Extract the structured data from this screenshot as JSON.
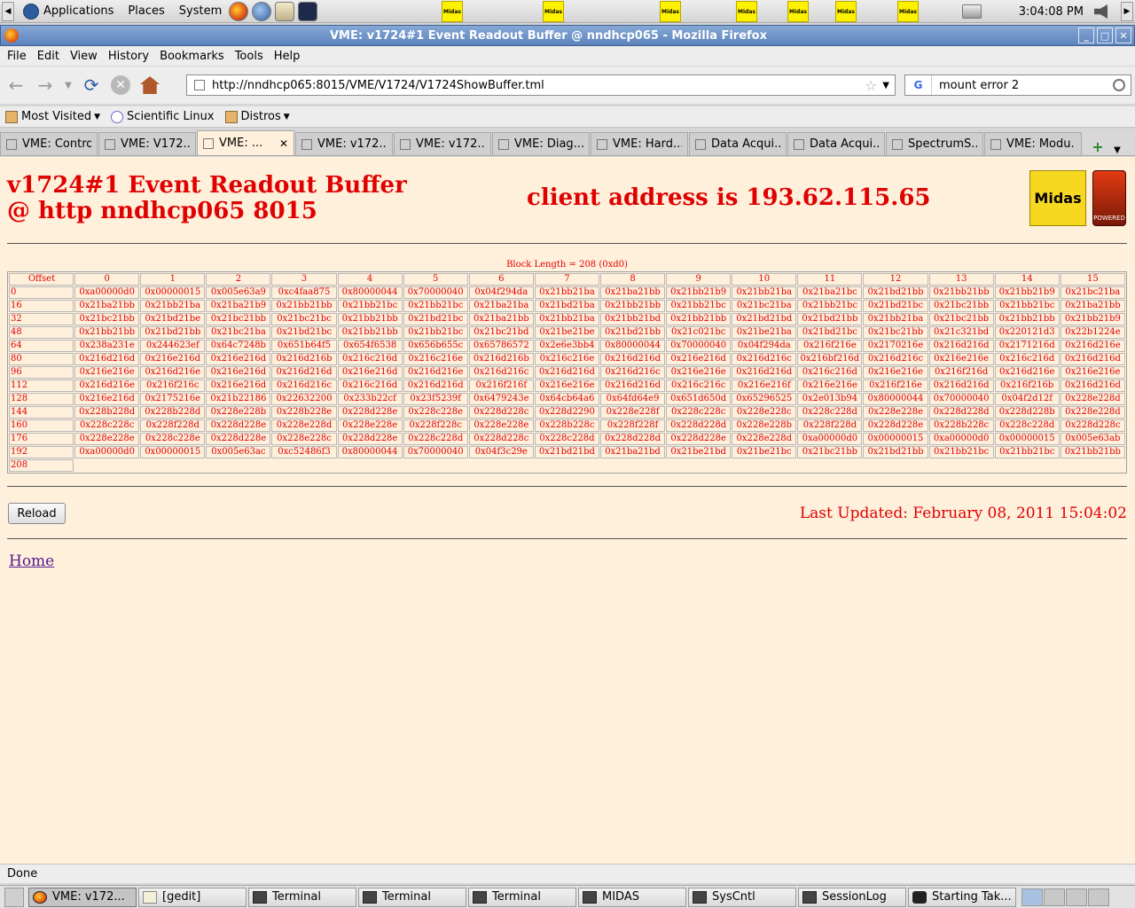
{
  "panel": {
    "menus": [
      "Applications",
      "Places",
      "System"
    ],
    "clock": "3:04:08 PM",
    "tray_label": "Midas"
  },
  "window": {
    "title": "VME: v1724#1 Event Readout Buffer @ nndhcp065 - Mozilla Firefox"
  },
  "menubar": [
    "File",
    "Edit",
    "View",
    "History",
    "Bookmarks",
    "Tools",
    "Help"
  ],
  "navbar": {
    "url": "http://nndhcp065:8015/VME/V1724/V1724ShowBuffer.tml",
    "search": "mount error 2",
    "search_engine": "G"
  },
  "bookmarks": [
    "Most Visited",
    "Scientific Linux",
    "Distros"
  ],
  "tabs": [
    {
      "label": "VME: Control"
    },
    {
      "label": "VME: V172..."
    },
    {
      "label": "VME: ..."
    },
    {
      "label": "VME: v172..."
    },
    {
      "label": "VME: v172..."
    },
    {
      "label": "VME: Diag..."
    },
    {
      "label": "VME: Hard..."
    },
    {
      "label": "Data Acqui..."
    },
    {
      "label": "Data Acqui..."
    },
    {
      "label": "SpectrumS..."
    },
    {
      "label": "VME: Modu..."
    }
  ],
  "page": {
    "heading": "v1724#1 Event Readout Buffer @ http nndhcp065 8015",
    "client": "client address is 193.62.115.65",
    "midas_logo": "Midas",
    "tcl_logo": "POWERED",
    "block_length": "Block Length = 208 (0xd0)",
    "columns": [
      "Offset",
      "0",
      "1",
      "2",
      "3",
      "4",
      "5",
      "6",
      "7",
      "8",
      "9",
      "10",
      "11",
      "12",
      "13",
      "14",
      "15"
    ],
    "rows": [
      [
        "0",
        "0xa00000d0",
        "0x00000015",
        "0x005e63a9",
        "0xc4faa875",
        "0x80000044",
        "0x70000040",
        "0x04f294da",
        "0x21bb21ba",
        "0x21ba21bb",
        "0x21bb21b9",
        "0x21bb21ba",
        "0x21ba21bc",
        "0x21bd21bb",
        "0x21bb21bb",
        "0x21bb21b9",
        "0x21bc21ba"
      ],
      [
        "16",
        "0x21ba21bb",
        "0x21bb21ba",
        "0x21ba21b9",
        "0x21bb21bb",
        "0x21bb21bc",
        "0x21bb21bc",
        "0x21ba21ba",
        "0x21bd21ba",
        "0x21bb21bb",
        "0x21bb21bc",
        "0x21bc21ba",
        "0x21bb21bc",
        "0x21bd21bc",
        "0x21bc21bb",
        "0x21bb21bc",
        "0x21ba21bb"
      ],
      [
        "32",
        "0x21bc21bb",
        "0x21bd21be",
        "0x21bc21bb",
        "0x21bc21bc",
        "0x21bb21bb",
        "0x21bd21bc",
        "0x21ba21bb",
        "0x21bb21ba",
        "0x21bb21bd",
        "0x21bb21bb",
        "0x21bd21bd",
        "0x21bd21bb",
        "0x21bb21ba",
        "0x21bc21bb",
        "0x21bb21bb",
        "0x21bb21b9"
      ],
      [
        "48",
        "0x21bb21bb",
        "0x21bd21bb",
        "0x21bc21ba",
        "0x21bd21bc",
        "0x21bb21bb",
        "0x21bb21bc",
        "0x21bc21bd",
        "0x21be21be",
        "0x21bd21bb",
        "0x21c021bc",
        "0x21be21ba",
        "0x21bd21bc",
        "0x21bc21bb",
        "0x21c321bd",
        "0x220121d3",
        "0x22b1224e"
      ],
      [
        "64",
        "0x238a231e",
        "0x244623ef",
        "0x64c7248b",
        "0x651b64f5",
        "0x654f6538",
        "0x656b655c",
        "0x65786572",
        "0x2e6e3bb4",
        "0x80000044",
        "0x70000040",
        "0x04f294da",
        "0x216f216e",
        "0x2170216e",
        "0x216d216d",
        "0x2171216d",
        "0x216d216e"
      ],
      [
        "80",
        "0x216d216d",
        "0x216e216d",
        "0x216e216d",
        "0x216d216b",
        "0x216c216d",
        "0x216c216e",
        "0x216d216b",
        "0x216c216e",
        "0x216d216d",
        "0x216e216d",
        "0x216d216c",
        "0x216bf216d",
        "0x216d216c",
        "0x216e216e",
        "0x216c216d",
        "0x216d216d"
      ],
      [
        "96",
        "0x216e216e",
        "0x216d216e",
        "0x216e216d",
        "0x216d216d",
        "0x216e216d",
        "0x216d216e",
        "0x216d216c",
        "0x216d216d",
        "0x216d216c",
        "0x216e216e",
        "0x216d216d",
        "0x216c216d",
        "0x216e216e",
        "0x216f216d",
        "0x216d216e",
        "0x216e216e"
      ],
      [
        "112",
        "0x216d216e",
        "0x216f216c",
        "0x216e216d",
        "0x216d216c",
        "0x216c216d",
        "0x216d216d",
        "0x216f216f",
        "0x216e216e",
        "0x216d216d",
        "0x216c216c",
        "0x216e216f",
        "0x216e216e",
        "0x216f216e",
        "0x216d216d",
        "0x216f216b",
        "0x216d216d"
      ],
      [
        "128",
        "0x216e216d",
        "0x2175216e",
        "0x21b22186",
        "0x22632200",
        "0x233b22cf",
        "0x23f5239f",
        "0x6479243e",
        "0x64cb64a6",
        "0x64fd64e9",
        "0x651d650d",
        "0x65296525",
        "0x2e013b94",
        "0x80000044",
        "0x70000040",
        "0x04f2d12f",
        "0x228e228d"
      ],
      [
        "144",
        "0x228b228d",
        "0x228b228d",
        "0x228e228b",
        "0x228b228e",
        "0x228d228e",
        "0x228c228e",
        "0x228d228c",
        "0x228d2290",
        "0x228e228f",
        "0x228c228c",
        "0x228e228c",
        "0x228c228d",
        "0x228e228e",
        "0x228d228d",
        "0x228d228b",
        "0x228e228d"
      ],
      [
        "160",
        "0x228c228c",
        "0x228f228d",
        "0x228d228e",
        "0x228e228d",
        "0x228e228e",
        "0x228f228c",
        "0x228e228e",
        "0x228b228c",
        "0x228f228f",
        "0x228d228d",
        "0x228e228b",
        "0x228f228d",
        "0x228d228e",
        "0x228b228c",
        "0x228c228d",
        "0x228d228c"
      ],
      [
        "176",
        "0x228e228e",
        "0x228c228e",
        "0x228d228e",
        "0x228e228c",
        "0x228d228e",
        "0x228c228d",
        "0x228d228c",
        "0x228c228d",
        "0x228d228d",
        "0x228d228e",
        "0x228e228d",
        "0xa00000d0",
        "0x00000015",
        "0xa00000d0",
        "0x00000015",
        "0x005e63ab"
      ],
      [
        "192",
        "0xa00000d0",
        "0x00000015",
        "0x005e63ac",
        "0xc52486f3",
        "0x80000044",
        "0x70000040",
        "0x04f3c29e",
        "0x21bd21bd",
        "0x21ba21bd",
        "0x21be21bd",
        "0x21be21bc",
        "0x21bc21bb",
        "0x21bd21bb",
        "0x21bb21bc",
        "0x21bb21bc",
        "0x21bb21bb"
      ],
      [
        "208"
      ]
    ],
    "reload_label": "Reload",
    "last_updated": "Last Updated: February 08, 2011 15:04:02",
    "home_link": "Home"
  },
  "status": "Done",
  "taskbar": [
    {
      "label": "VME: v172...",
      "icon": "firefox-icon"
    },
    {
      "label": "[gedit]",
      "icon": "gedit-icon"
    },
    {
      "label": "Terminal",
      "icon": "terminal-icon"
    },
    {
      "label": "Terminal",
      "icon": "terminal-icon"
    },
    {
      "label": "Terminal",
      "icon": "terminal-icon"
    },
    {
      "label": "MIDAS",
      "icon": "terminal-icon"
    },
    {
      "label": "SysCntl",
      "icon": "terminal-icon"
    },
    {
      "label": "SessionLog",
      "icon": "terminal-icon"
    },
    {
      "label": "Starting Tak...",
      "icon": "camera-icon"
    }
  ]
}
